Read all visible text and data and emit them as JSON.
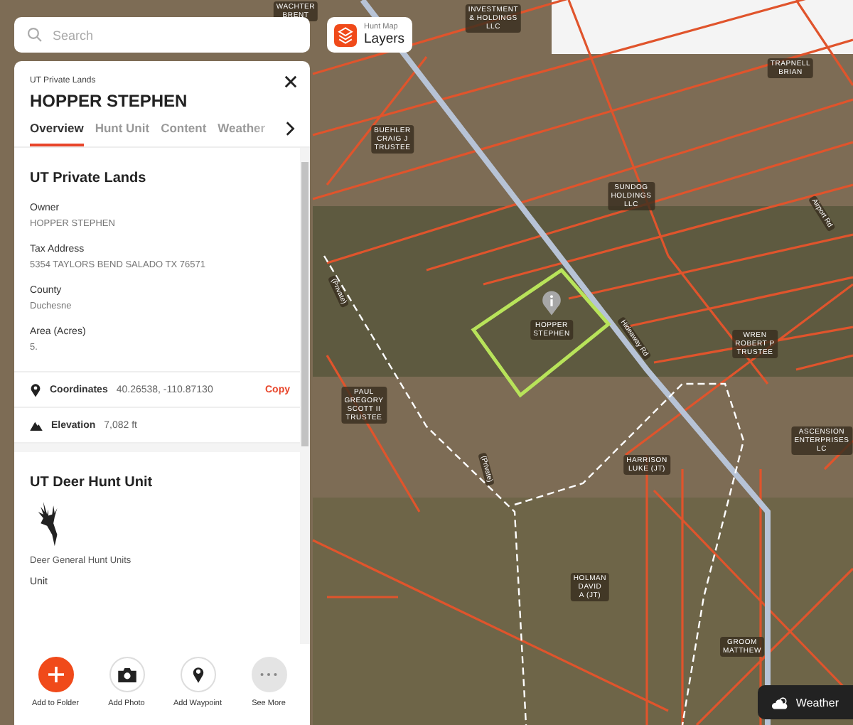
{
  "search": {
    "placeholder": "Search"
  },
  "layers_button": {
    "caption": "Hunt Map",
    "label": "Layers"
  },
  "panel": {
    "category": "UT Private Lands",
    "title": "HOPPER STEPHEN",
    "tabs": [
      {
        "label": "Overview",
        "selected": true
      },
      {
        "label": "Hunt Unit",
        "selected": false
      },
      {
        "label": "Content",
        "selected": false
      },
      {
        "label": "Weather",
        "selected": false
      }
    ],
    "section": {
      "heading": "UT Private Lands",
      "fields": [
        {
          "label": "Owner",
          "value": "HOPPER STEPHEN"
        },
        {
          "label": "Tax Address",
          "value": "5354 TAYLORS BEND SALADO TX 76571"
        },
        {
          "label": "County",
          "value": "Duchesne"
        },
        {
          "label": "Area (Acres)",
          "value": "5."
        }
      ]
    },
    "coordinates": {
      "label": "Coordinates",
      "value": "40.26538, -110.87130",
      "action": "Copy"
    },
    "elevation": {
      "label": "Elevation",
      "value": "7,082 ft"
    },
    "hunt_unit": {
      "heading": "UT Deer Hunt Unit",
      "caption": "Deer General Hunt Units",
      "field_label": "Unit"
    },
    "actions": [
      {
        "kind": "add",
        "label": "Add to Folder"
      },
      {
        "kind": "photo",
        "label": "Add Photo"
      },
      {
        "kind": "waypoint",
        "label": "Add Waypoint"
      },
      {
        "kind": "more",
        "label": "See More"
      }
    ]
  },
  "weather_button": {
    "label": "Weather"
  },
  "map_labels": [
    {
      "lines": [
        "WACHTER",
        "BRENT"
      ]
    },
    {
      "lines": [
        "INVESTMENT",
        "& HOLDINGS",
        "LLC"
      ]
    },
    {
      "lines": [
        "TRAPNELL",
        "BRIAN"
      ]
    },
    {
      "lines": [
        "BUEHLER",
        "CRAIG J",
        "TRUSTEE"
      ]
    },
    {
      "lines": [
        "SUNDOG",
        "HOLDINGS",
        "LLC"
      ]
    },
    {
      "lines": [
        "HOPPER",
        "STEPHEN"
      ]
    },
    {
      "lines": [
        "WREN",
        "ROBERT P",
        "TRUSTEE"
      ]
    },
    {
      "lines": [
        "PAUL",
        "GREGORY",
        "SCOTT II",
        "TRUSTEE"
      ]
    },
    {
      "lines": [
        "HARRISON",
        "LUKE (JT)"
      ]
    },
    {
      "lines": [
        "ASCENSION",
        "ENTERPRISES",
        "LC"
      ]
    },
    {
      "lines": [
        "HOLMAN",
        "DAVID",
        "A (JT)"
      ]
    },
    {
      "lines": [
        "GROOM",
        "MATTHEW"
      ]
    }
  ],
  "road_labels": [
    {
      "text": "Airport Rd"
    },
    {
      "text": "Hideaway Rd"
    },
    {
      "text": "(Private)"
    },
    {
      "text": "(Private)"
    }
  ]
}
